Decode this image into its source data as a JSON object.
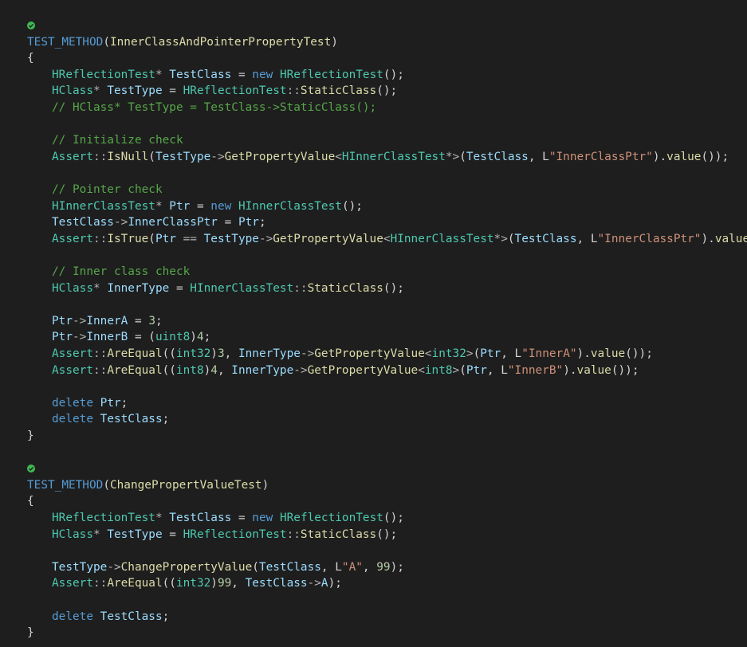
{
  "editor": {
    "test_passed_icon_color": "#3fb950",
    "colors": {
      "background": "#1e1e1e",
      "macro": "#569cd6",
      "function": "#dcdcaa",
      "type": "#4ec9b0",
      "variable": "#9cdcfe",
      "keyword": "#569cd6",
      "string": "#ce9178",
      "number": "#b5cea8",
      "comment": "#57a64a",
      "punctuation": "#d4d4d4"
    },
    "lines": [
      {
        "indent": 0,
        "glyph": "test-passed",
        "tokens": []
      },
      {
        "indent": 0,
        "tokens": [
          {
            "t": "TEST_METHOD",
            "k": "mac"
          },
          {
            "t": "(",
            "k": "pun"
          },
          {
            "t": "InnerClassAndPointerPropertyTest",
            "k": "fun"
          },
          {
            "t": ")",
            "k": "pun"
          }
        ]
      },
      {
        "indent": 0,
        "tokens": [
          {
            "t": "{",
            "k": "pun"
          }
        ]
      },
      {
        "indent": 1,
        "tokens": [
          {
            "t": "HReflectionTest",
            "k": "typ"
          },
          {
            "t": "* ",
            "k": "op"
          },
          {
            "t": "TestClass",
            "k": "var"
          },
          {
            "t": " = ",
            "k": "pun"
          },
          {
            "t": "new",
            "k": "kw"
          },
          {
            "t": " ",
            "k": "pun"
          },
          {
            "t": "HReflectionTest",
            "k": "typ"
          },
          {
            "t": "();",
            "k": "pun"
          }
        ]
      },
      {
        "indent": 1,
        "tokens": [
          {
            "t": "HClass",
            "k": "typ"
          },
          {
            "t": "* ",
            "k": "op"
          },
          {
            "t": "TestType",
            "k": "var"
          },
          {
            "t": " = ",
            "k": "pun"
          },
          {
            "t": "HReflectionTest",
            "k": "typ"
          },
          {
            "t": "::",
            "k": "op"
          },
          {
            "t": "StaticClass",
            "k": "fun"
          },
          {
            "t": "();",
            "k": "pun"
          }
        ]
      },
      {
        "indent": 1,
        "tokens": [
          {
            "t": "// HClass* TestType = TestClass->StaticClass();",
            "k": "com"
          }
        ]
      },
      {
        "indent": 0,
        "tokens": []
      },
      {
        "indent": 1,
        "tokens": [
          {
            "t": "// Initialize check",
            "k": "com"
          }
        ]
      },
      {
        "indent": 1,
        "tokens": [
          {
            "t": "Assert",
            "k": "typ"
          },
          {
            "t": "::",
            "k": "op"
          },
          {
            "t": "IsNull",
            "k": "fun"
          },
          {
            "t": "(",
            "k": "pun"
          },
          {
            "t": "TestType",
            "k": "var"
          },
          {
            "t": "->",
            "k": "op"
          },
          {
            "t": "GetPropertyValue",
            "k": "fun"
          },
          {
            "t": "<",
            "k": "op"
          },
          {
            "t": "HInnerClassTest",
            "k": "typ"
          },
          {
            "t": "*>",
            "k": "op"
          },
          {
            "t": "(",
            "k": "pun"
          },
          {
            "t": "TestClass",
            "k": "var"
          },
          {
            "t": ", L",
            "k": "pun"
          },
          {
            "t": "\"InnerClassPtr\"",
            "k": "str"
          },
          {
            "t": ").",
            "k": "pun"
          },
          {
            "t": "value",
            "k": "fun"
          },
          {
            "t": "());",
            "k": "pun"
          }
        ]
      },
      {
        "indent": 0,
        "tokens": []
      },
      {
        "indent": 1,
        "tokens": [
          {
            "t": "// Pointer check",
            "k": "com"
          }
        ]
      },
      {
        "indent": 1,
        "tokens": [
          {
            "t": "HInnerClassTest",
            "k": "typ"
          },
          {
            "t": "* ",
            "k": "op"
          },
          {
            "t": "Ptr",
            "k": "var"
          },
          {
            "t": " = ",
            "k": "pun"
          },
          {
            "t": "new",
            "k": "kw"
          },
          {
            "t": " ",
            "k": "pun"
          },
          {
            "t": "HInnerClassTest",
            "k": "typ"
          },
          {
            "t": "();",
            "k": "pun"
          }
        ]
      },
      {
        "indent": 1,
        "tokens": [
          {
            "t": "TestClass",
            "k": "var"
          },
          {
            "t": "->",
            "k": "op"
          },
          {
            "t": "InnerClassPtr",
            "k": "var"
          },
          {
            "t": " = ",
            "k": "pun"
          },
          {
            "t": "Ptr",
            "k": "var"
          },
          {
            "t": ";",
            "k": "pun"
          }
        ]
      },
      {
        "indent": 1,
        "tokens": [
          {
            "t": "Assert",
            "k": "typ"
          },
          {
            "t": "::",
            "k": "op"
          },
          {
            "t": "IsTrue",
            "k": "fun"
          },
          {
            "t": "(",
            "k": "pun"
          },
          {
            "t": "Ptr",
            "k": "var"
          },
          {
            "t": " == ",
            "k": "op"
          },
          {
            "t": "TestType",
            "k": "var"
          },
          {
            "t": "->",
            "k": "op"
          },
          {
            "t": "GetPropertyValue",
            "k": "fun"
          },
          {
            "t": "<",
            "k": "op"
          },
          {
            "t": "HInnerClassTest",
            "k": "typ"
          },
          {
            "t": "*>",
            "k": "op"
          },
          {
            "t": "(",
            "k": "pun"
          },
          {
            "t": "TestClass",
            "k": "var"
          },
          {
            "t": ", L",
            "k": "pun"
          },
          {
            "t": "\"InnerClassPtr\"",
            "k": "str"
          },
          {
            "t": ").",
            "k": "pun"
          },
          {
            "t": "value",
            "k": "fun"
          },
          {
            "t": "());",
            "k": "pun"
          }
        ]
      },
      {
        "indent": 0,
        "tokens": []
      },
      {
        "indent": 1,
        "tokens": [
          {
            "t": "// Inner class check",
            "k": "com"
          }
        ]
      },
      {
        "indent": 1,
        "tokens": [
          {
            "t": "HClass",
            "k": "typ"
          },
          {
            "t": "* ",
            "k": "op"
          },
          {
            "t": "InnerType",
            "k": "var"
          },
          {
            "t": " = ",
            "k": "pun"
          },
          {
            "t": "HInnerClassTest",
            "k": "typ"
          },
          {
            "t": "::",
            "k": "op"
          },
          {
            "t": "StaticClass",
            "k": "fun"
          },
          {
            "t": "();",
            "k": "pun"
          }
        ]
      },
      {
        "indent": 0,
        "tokens": []
      },
      {
        "indent": 1,
        "tokens": [
          {
            "t": "Ptr",
            "k": "var"
          },
          {
            "t": "->",
            "k": "op"
          },
          {
            "t": "InnerA",
            "k": "var"
          },
          {
            "t": " = ",
            "k": "pun"
          },
          {
            "t": "3",
            "k": "num"
          },
          {
            "t": ";",
            "k": "pun"
          }
        ]
      },
      {
        "indent": 1,
        "tokens": [
          {
            "t": "Ptr",
            "k": "var"
          },
          {
            "t": "->",
            "k": "op"
          },
          {
            "t": "InnerB",
            "k": "var"
          },
          {
            "t": " = (",
            "k": "pun"
          },
          {
            "t": "uint8",
            "k": "typ"
          },
          {
            "t": ")",
            "k": "pun"
          },
          {
            "t": "4",
            "k": "num"
          },
          {
            "t": ";",
            "k": "pun"
          }
        ]
      },
      {
        "indent": 1,
        "tokens": [
          {
            "t": "Assert",
            "k": "typ"
          },
          {
            "t": "::",
            "k": "op"
          },
          {
            "t": "AreEqual",
            "k": "fun"
          },
          {
            "t": "((",
            "k": "pun"
          },
          {
            "t": "int32",
            "k": "typ"
          },
          {
            "t": ")",
            "k": "pun"
          },
          {
            "t": "3",
            "k": "num"
          },
          {
            "t": ", ",
            "k": "pun"
          },
          {
            "t": "InnerType",
            "k": "var"
          },
          {
            "t": "->",
            "k": "op"
          },
          {
            "t": "GetPropertyValue",
            "k": "fun"
          },
          {
            "t": "<",
            "k": "op"
          },
          {
            "t": "int32",
            "k": "typ"
          },
          {
            "t": ">",
            "k": "op"
          },
          {
            "t": "(",
            "k": "pun"
          },
          {
            "t": "Ptr",
            "k": "var"
          },
          {
            "t": ", L",
            "k": "pun"
          },
          {
            "t": "\"InnerA\"",
            "k": "str"
          },
          {
            "t": ").",
            "k": "pun"
          },
          {
            "t": "value",
            "k": "fun"
          },
          {
            "t": "());",
            "k": "pun"
          }
        ]
      },
      {
        "indent": 1,
        "tokens": [
          {
            "t": "Assert",
            "k": "typ"
          },
          {
            "t": "::",
            "k": "op"
          },
          {
            "t": "AreEqual",
            "k": "fun"
          },
          {
            "t": "((",
            "k": "pun"
          },
          {
            "t": "int8",
            "k": "typ"
          },
          {
            "t": ")",
            "k": "pun"
          },
          {
            "t": "4",
            "k": "num"
          },
          {
            "t": ", ",
            "k": "pun"
          },
          {
            "t": "InnerType",
            "k": "var"
          },
          {
            "t": "->",
            "k": "op"
          },
          {
            "t": "GetPropertyValue",
            "k": "fun"
          },
          {
            "t": "<",
            "k": "op"
          },
          {
            "t": "int8",
            "k": "typ"
          },
          {
            "t": ">",
            "k": "op"
          },
          {
            "t": "(",
            "k": "pun"
          },
          {
            "t": "Ptr",
            "k": "var"
          },
          {
            "t": ", L",
            "k": "pun"
          },
          {
            "t": "\"InnerB\"",
            "k": "str"
          },
          {
            "t": ").",
            "k": "pun"
          },
          {
            "t": "value",
            "k": "fun"
          },
          {
            "t": "());",
            "k": "pun"
          }
        ]
      },
      {
        "indent": 0,
        "tokens": []
      },
      {
        "indent": 1,
        "tokens": [
          {
            "t": "delete",
            "k": "kw"
          },
          {
            "t": " ",
            "k": "pun"
          },
          {
            "t": "Ptr",
            "k": "var"
          },
          {
            "t": ";",
            "k": "pun"
          }
        ]
      },
      {
        "indent": 1,
        "tokens": [
          {
            "t": "delete",
            "k": "kw"
          },
          {
            "t": " ",
            "k": "pun"
          },
          {
            "t": "TestClass",
            "k": "var"
          },
          {
            "t": ";",
            "k": "pun"
          }
        ]
      },
      {
        "indent": 0,
        "tokens": [
          {
            "t": "}",
            "k": "pun"
          }
        ]
      },
      {
        "indent": 0,
        "tokens": []
      },
      {
        "indent": 0,
        "glyph": "test-passed",
        "tokens": []
      },
      {
        "indent": 0,
        "tokens": [
          {
            "t": "TEST_METHOD",
            "k": "mac"
          },
          {
            "t": "(",
            "k": "pun"
          },
          {
            "t": "ChangePropertValueTest",
            "k": "fun"
          },
          {
            "t": ")",
            "k": "pun"
          }
        ]
      },
      {
        "indent": 0,
        "tokens": [
          {
            "t": "{",
            "k": "pun"
          }
        ]
      },
      {
        "indent": 1,
        "tokens": [
          {
            "t": "HReflectionTest",
            "k": "typ"
          },
          {
            "t": "* ",
            "k": "op"
          },
          {
            "t": "TestClass",
            "k": "var"
          },
          {
            "t": " = ",
            "k": "pun"
          },
          {
            "t": "new",
            "k": "kw"
          },
          {
            "t": " ",
            "k": "pun"
          },
          {
            "t": "HReflectionTest",
            "k": "typ"
          },
          {
            "t": "();",
            "k": "pun"
          }
        ]
      },
      {
        "indent": 1,
        "tokens": [
          {
            "t": "HClass",
            "k": "typ"
          },
          {
            "t": "* ",
            "k": "op"
          },
          {
            "t": "TestType",
            "k": "var"
          },
          {
            "t": " = ",
            "k": "pun"
          },
          {
            "t": "HReflectionTest",
            "k": "typ"
          },
          {
            "t": "::",
            "k": "op"
          },
          {
            "t": "StaticClass",
            "k": "fun"
          },
          {
            "t": "();",
            "k": "pun"
          }
        ]
      },
      {
        "indent": 0,
        "tokens": []
      },
      {
        "indent": 1,
        "tokens": [
          {
            "t": "TestType",
            "k": "var"
          },
          {
            "t": "->",
            "k": "op"
          },
          {
            "t": "ChangePropertyValue",
            "k": "fun"
          },
          {
            "t": "(",
            "k": "pun"
          },
          {
            "t": "TestClass",
            "k": "var"
          },
          {
            "t": ", L",
            "k": "pun"
          },
          {
            "t": "\"A\"",
            "k": "str"
          },
          {
            "t": ", ",
            "k": "pun"
          },
          {
            "t": "99",
            "k": "num"
          },
          {
            "t": ");",
            "k": "pun"
          }
        ]
      },
      {
        "indent": 1,
        "tokens": [
          {
            "t": "Assert",
            "k": "typ"
          },
          {
            "t": "::",
            "k": "op"
          },
          {
            "t": "AreEqual",
            "k": "fun"
          },
          {
            "t": "((",
            "k": "pun"
          },
          {
            "t": "int32",
            "k": "typ"
          },
          {
            "t": ")",
            "k": "pun"
          },
          {
            "t": "99",
            "k": "num"
          },
          {
            "t": ", ",
            "k": "pun"
          },
          {
            "t": "TestClass",
            "k": "var"
          },
          {
            "t": "->",
            "k": "op"
          },
          {
            "t": "A",
            "k": "var"
          },
          {
            "t": ");",
            "k": "pun"
          }
        ]
      },
      {
        "indent": 0,
        "tokens": []
      },
      {
        "indent": 1,
        "tokens": [
          {
            "t": "delete",
            "k": "kw"
          },
          {
            "t": " ",
            "k": "pun"
          },
          {
            "t": "TestClass",
            "k": "var"
          },
          {
            "t": ";",
            "k": "pun"
          }
        ]
      },
      {
        "indent": 0,
        "tokens": [
          {
            "t": "}",
            "k": "pun"
          }
        ]
      }
    ]
  }
}
